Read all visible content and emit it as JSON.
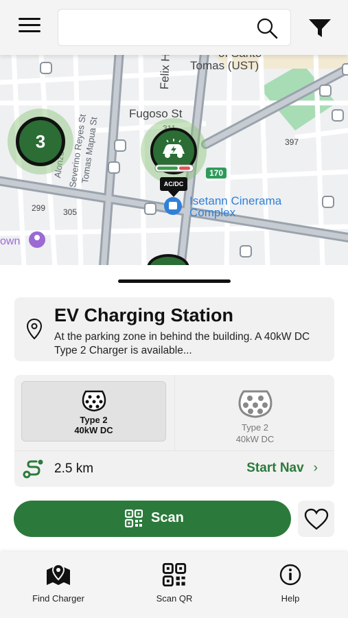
{
  "header": {
    "search_placeholder": "",
    "menu_icon": "hamburger-menu-icon",
    "search_icon": "search-icon",
    "filter_icon": "filter-funnel-icon"
  },
  "map": {
    "labels": {
      "tomas": "Tomas (UST)",
      "sto": "of Santo",
      "felix": "Felix Hu",
      "fugoso": "Fugoso St",
      "severino": "Severino Reyes St",
      "tomas_mapua": "Tomas Mapua St",
      "alonzo": "Alonzo",
      "n299": "299",
      "n305": "305",
      "n311": "311",
      "n397": "397",
      "road170": "170",
      "own": "own",
      "poi_line1": "Isetann Cinerama",
      "poi_line2": "Complex"
    },
    "cluster_count": "3",
    "marker_tag": "AC/DC"
  },
  "station": {
    "title": "EV Charging Station",
    "description": "At the parking zone in behind the building. A 40kW DC Type 2 Charger is available..."
  },
  "connectors": [
    {
      "type": "Type 2",
      "power": "40kW DC",
      "selected": true
    },
    {
      "type": "Type 2",
      "power": "40kW DC",
      "selected": false
    }
  ],
  "route": {
    "distance": "2.5 km",
    "start_nav_label": "Start Nav",
    "chevron": "›"
  },
  "actions": {
    "scan_label": "Scan"
  },
  "bottom_nav": {
    "items": [
      {
        "label": "Find Charger",
        "icon": "map-marker-icon"
      },
      {
        "label": "Scan QR",
        "icon": "qr-code-icon"
      },
      {
        "label": "Help",
        "icon": "info-icon"
      }
    ]
  },
  "colors": {
    "brand_green": "#2b7a3b",
    "marker_green": "#2b6d35",
    "halo_green": "#8ac476",
    "poi_blue": "#2f80d8"
  }
}
